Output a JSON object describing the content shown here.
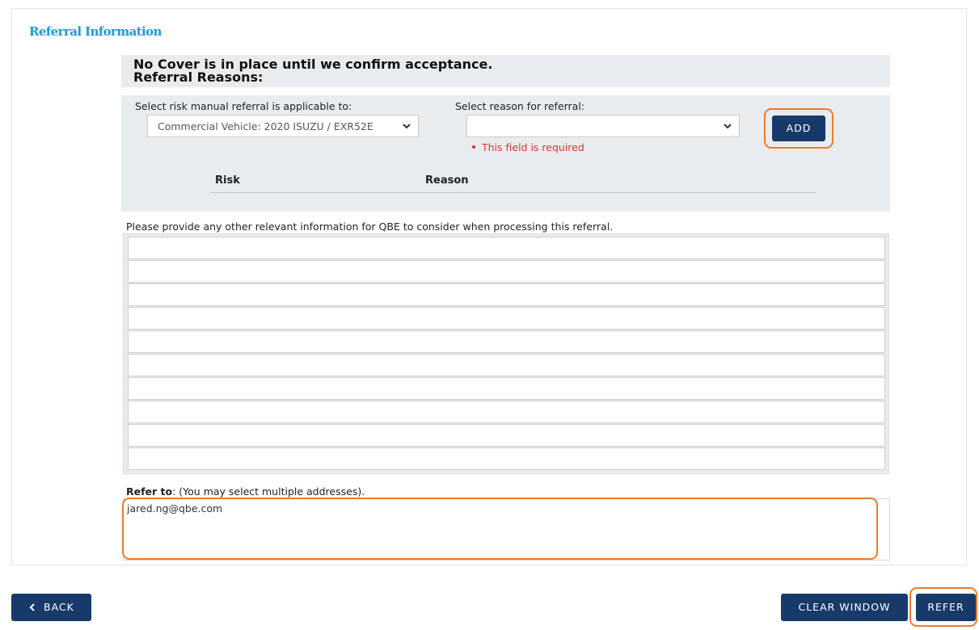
{
  "section": {
    "title": "Referral Information"
  },
  "notice": {
    "line1": "No Cover is in place until we confirm acceptance.",
    "line2": "Referral Reasons:"
  },
  "referral": {
    "risk_label": "Select risk manual referral is applicable to:",
    "risk_value": "Commercial Vehicle: 2020 ISUZU / EXR52E",
    "reason_label": "Select reason for referral:",
    "reason_value": "",
    "reason_error": "This field is required",
    "add_label": "ADD",
    "columns": [
      "Risk",
      "Reason"
    ]
  },
  "info": {
    "label": "Please provide any other relevant information for QBE to consider when processing this referral.",
    "lines": 10
  },
  "refer_to": {
    "label_bold": "Refer to",
    "label_rest": ": (You may select multiple addresses).",
    "addresses": [
      "jared.ng@qbe.com"
    ]
  },
  "footer": {
    "back_label": "BACK",
    "clear_label": "CLEAR WINDOW",
    "refer_label": "REFER"
  },
  "colors": {
    "accent_title": "#1f9ad6",
    "button": "#173a6b",
    "highlight": "#ee7a2a",
    "error": "#e03131"
  }
}
